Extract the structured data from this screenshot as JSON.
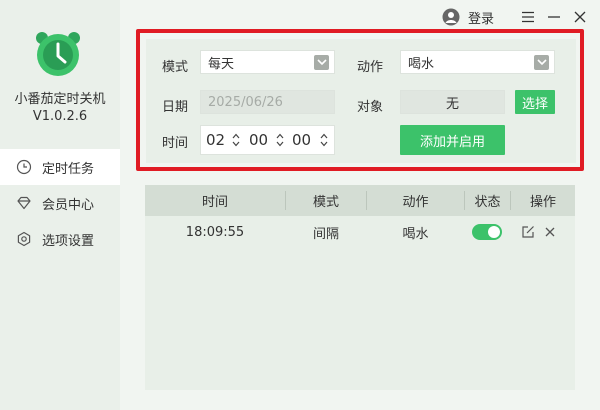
{
  "app": {
    "name": "小番茄定时关机",
    "version": "V1.0.2.6",
    "brand_color": "#3cc26a",
    "accent_red": "#e01b24"
  },
  "topbar": {
    "login_label": "登录",
    "icons": [
      "user-avatar-icon",
      "menu-icon",
      "minimize-icon",
      "close-icon"
    ]
  },
  "sidebar": {
    "items": [
      {
        "label": "定时任务",
        "icon": "clock-icon",
        "active": true
      },
      {
        "label": "会员中心",
        "icon": "diamond-icon",
        "active": false
      },
      {
        "label": "选项设置",
        "icon": "settings-icon",
        "active": false
      }
    ]
  },
  "form": {
    "mode_label": "模式",
    "mode_value": "每天",
    "action_label": "动作",
    "action_value": "喝水",
    "date_label": "日期",
    "date_placeholder": "2025/06/26",
    "target_label": "对象",
    "target_value": "无",
    "choose_button": "选择",
    "time_label": "时间",
    "hour": "02",
    "minute": "00",
    "second": "00",
    "submit_button": "添加并启用"
  },
  "table": {
    "columns": [
      "时间",
      "模式",
      "动作",
      "状态",
      "操作"
    ],
    "rows": [
      {
        "time": "18:09:55",
        "mode": "间隔",
        "action": "喝水",
        "enabled": true
      }
    ]
  }
}
